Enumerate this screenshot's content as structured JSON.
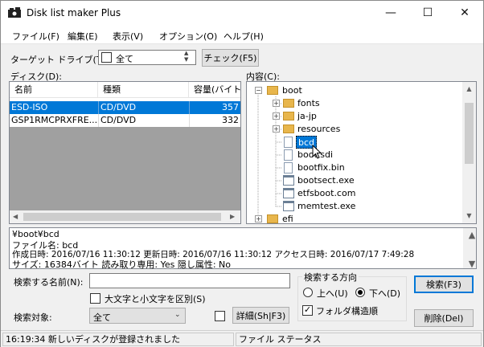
{
  "window": {
    "title": "Disk list maker Plus",
    "minimize": "—",
    "maximize": "☐",
    "close": "✕"
  },
  "menu": [
    "ファイル(F)",
    "編集(E)",
    "表示(V)",
    "オプション(O)",
    "ヘルプ(H)"
  ],
  "target": {
    "label": "ターゲット ドライブ(T):",
    "value": "全て",
    "check_button": "チェック(F5)"
  },
  "disk": {
    "label": "ディスク(D):",
    "columns": [
      "名前",
      "種類",
      "容量(バイト"
    ],
    "rows": [
      {
        "name": "ESD-ISO",
        "type": "CD/DVD",
        "size": "357",
        "selected": true
      },
      {
        "name": "GSP1RMCPRXFRE...",
        "type": "CD/DVD",
        "size": "332",
        "selected": false
      }
    ]
  },
  "contents": {
    "label": "内容(C):",
    "tree": [
      {
        "label": "boot",
        "kind": "folder",
        "expander": "−"
      },
      {
        "label": "fonts",
        "kind": "folder",
        "expander": "+"
      },
      {
        "label": "ja-jp",
        "kind": "folder",
        "expander": "+"
      },
      {
        "label": "resources",
        "kind": "folder",
        "expander": "+"
      },
      {
        "label": "bcd",
        "kind": "file",
        "selected": true
      },
      {
        "label": "boot.sdi",
        "kind": "file"
      },
      {
        "label": "bootfix.bin",
        "kind": "file"
      },
      {
        "label": "bootsect.exe",
        "kind": "exe"
      },
      {
        "label": "etfsboot.com",
        "kind": "exe"
      },
      {
        "label": "memtest.exe",
        "kind": "exe"
      },
      {
        "label": "efi",
        "kind": "folder",
        "expander": "+"
      }
    ]
  },
  "info": {
    "line1": "¥boot¥bcd",
    "line2": "ファイル名: bcd",
    "line3": "作成日時: 2016/07/16 11:30:12 更新日時: 2016/07/16 11:30:12 アクセス日時: 2016/07/17 7:49:28",
    "line4": "サイズ: 16384バイト 読み取り専用: Yes 隠し属性: No"
  },
  "search": {
    "name_label": "検索する名前(N):",
    "name_value": "",
    "case_label": "大文字と小文字を区別(S)",
    "target_label": "検索対象:",
    "target_value": "全て",
    "detail_button": "詳細(Sh|F3)",
    "direction_label": "検索する方向",
    "up_label": "上へ(U)",
    "down_label": "下へ(D)",
    "folder_order_label": "フォルダ構造順",
    "search_button": "検索(F3)",
    "delete_button": "削除(Del)"
  },
  "status": {
    "message": "16:19:34 新しいディスクが登録されました",
    "file_status": "ファイル ステータス"
  }
}
